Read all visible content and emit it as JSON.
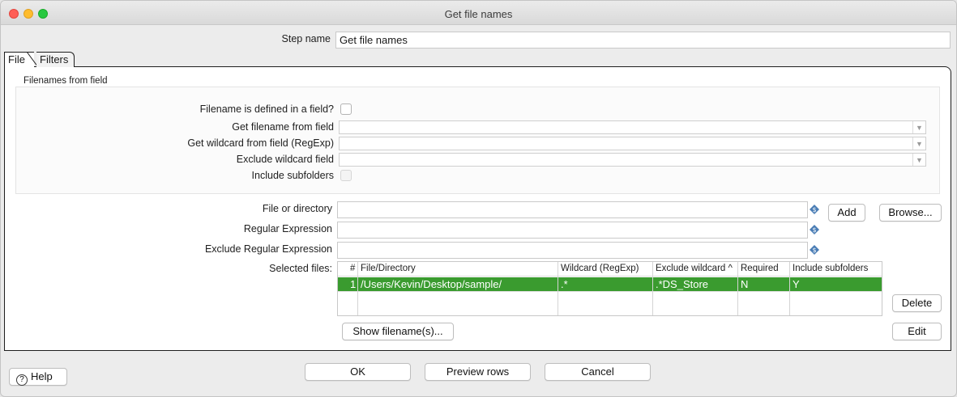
{
  "window": {
    "title": "Get file names"
  },
  "step_name": {
    "label": "Step name",
    "value": "Get file names"
  },
  "tabs": [
    {
      "label": "File"
    },
    {
      "label": "Filters"
    }
  ],
  "filenames_from_field": {
    "section_title": "Filenames from field",
    "defined_in_field_label": "Filename is defined in a field?",
    "get_filename_label": "Get filename from field",
    "get_wildcard_label": "Get wildcard from field (RegExp)",
    "exclude_wildcard_label": "Exclude wildcard field",
    "include_subfolders_label": "Include subfolders",
    "get_filename_value": "",
    "get_wildcard_value": "",
    "exclude_wildcard_value": ""
  },
  "file_inputs": {
    "file_or_directory_label": "File or directory",
    "file_or_directory_value": "",
    "regex_label": "Regular Expression",
    "regex_value": "",
    "exclude_regex_label": "Exclude Regular Expression",
    "exclude_regex_value": ""
  },
  "buttons": {
    "add": "Add",
    "browse": "Browse...",
    "delete": "Delete",
    "edit": "Edit",
    "show_filenames": "Show filename(s)...",
    "help": "Help",
    "ok": "OK",
    "preview_rows": "Preview rows",
    "cancel": "Cancel"
  },
  "selected_files": {
    "label": "Selected files:",
    "columns": [
      "#",
      "File/Directory",
      "Wildcard (RegExp)",
      "Exclude wildcard",
      "Required",
      "Include subfolders"
    ],
    "sort_indicator": "^",
    "rows": [
      {
        "num": "1",
        "file": "/Users/Kevin/Desktop/sample/",
        "wildcard": ".*",
        "exclude": ".*DS_Store",
        "required": "N",
        "subfolders": "Y"
      }
    ]
  },
  "colors": {
    "selected_row": "#3a9b2f",
    "variable_icon": "#4a7db5"
  }
}
